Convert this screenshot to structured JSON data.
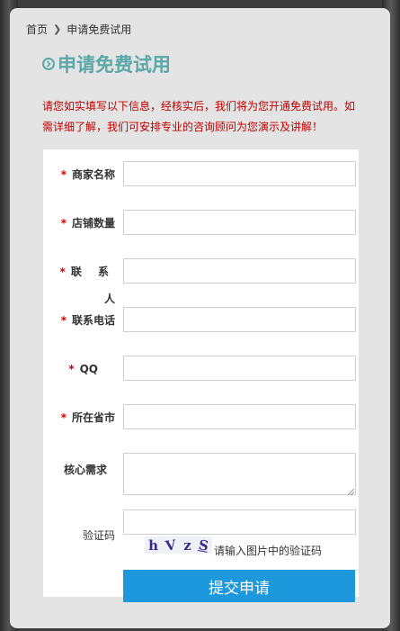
{
  "breadcrumb": {
    "home": "首页",
    "current": "申请免费试用"
  },
  "page": {
    "title": "申请免费试用",
    "intro": "请您如实填写以下信息，经核实后，我们将为您开通免费试用。如需详细了解，我们可安排专业的咨询顾问为您演示及讲解！"
  },
  "form": {
    "required_mark": "*",
    "fields": {
      "merchant_name": {
        "label": "商家名称",
        "value": ""
      },
      "store_count": {
        "label": "店铺数量",
        "value": ""
      },
      "contact": {
        "label": "联 系 人",
        "value": ""
      },
      "phone": {
        "label": "联系电话",
        "value": ""
      },
      "qq": {
        "label": "QQ",
        "value": ""
      },
      "province_city": {
        "label": "所在省市",
        "value": ""
      },
      "core_needs": {
        "label": "核心需求",
        "value": ""
      },
      "captcha": {
        "label": "验证码",
        "value": ""
      }
    },
    "captcha_chars": [
      "h",
      "V",
      "z",
      "S"
    ],
    "captcha_hint": "请输入图片中的验证码",
    "submit_label": "提交申请"
  },
  "colors": {
    "accent": "#1e98dd",
    "title": "#5aa8a8",
    "required": "#d00000",
    "intro": "#c00000"
  },
  "icons": {
    "breadcrumb_separator": "chevron-right-icon",
    "title": "circle-chevron-right-icon"
  }
}
